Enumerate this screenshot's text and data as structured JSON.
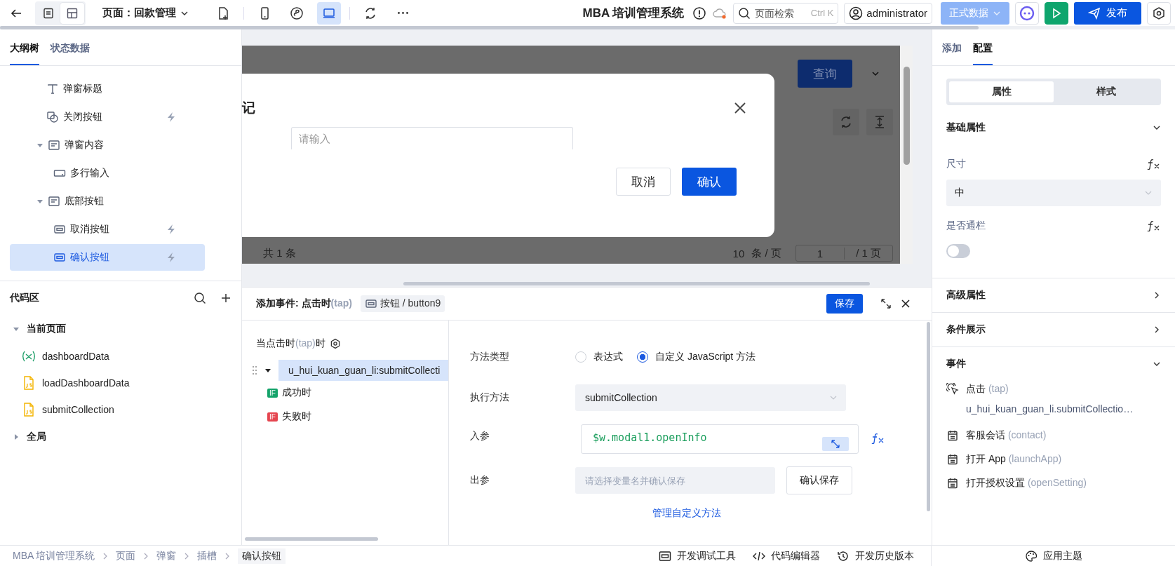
{
  "top_bar": {
    "view_modes": [
      {
        "kind": "list",
        "selected": false
      },
      {
        "kind": "layout",
        "selected": true
      }
    ],
    "page_selector": "页面：回款管理",
    "devices": [
      {
        "kind": "add",
        "selected": false
      },
      {
        "kind": "phone",
        "selected": false
      },
      {
        "kind": "mini",
        "selected": false
      },
      {
        "kind": "desktop",
        "selected": true
      },
      {
        "kind": "refresh",
        "selected": false
      },
      {
        "kind": "more",
        "selected": false
      }
    ],
    "app_title": "MBA 培训管理系统",
    "search": {
      "placeholder": "页面检索",
      "shortcut": "Ctrl K"
    },
    "user": "administrator",
    "env_button": "正式数据",
    "publish_button": "发布"
  },
  "left_panel": {
    "tabs": [
      {
        "label": "大纲树",
        "selected": true
      },
      {
        "label": "状态数据",
        "selected": false
      }
    ],
    "outline": [
      {
        "label": "弹窗标题",
        "kind": "text",
        "has_event": false,
        "selected": false
      },
      {
        "label": "关闭按钮",
        "kind": "shape",
        "has_event": true,
        "selected": false
      },
      {
        "label": "弹窗内容",
        "kind": "container",
        "has_event": false,
        "selected": false,
        "expanded": true,
        "children": [
          {
            "label": "多行输入",
            "kind": "input",
            "has_event": false,
            "selected": false
          }
        ]
      },
      {
        "label": "底部按钮",
        "kind": "container",
        "has_event": false,
        "selected": false,
        "expanded": true,
        "children": [
          {
            "label": "取消按钮",
            "kind": "button",
            "has_event": true,
            "selected": false
          },
          {
            "label": "确认按钮",
            "kind": "button",
            "has_event": true,
            "selected": true
          }
        ]
      }
    ],
    "code_area": {
      "title": "代码区",
      "groups": [
        {
          "label": "当前页面",
          "expanded": true,
          "children": [
            {
              "label": "dashboardData",
              "kind": "variable"
            },
            {
              "label": "loadDashboardData",
              "kind": "js"
            },
            {
              "label": "submitCollection",
              "kind": "js"
            }
          ]
        },
        {
          "label": "全局",
          "expanded": false
        }
      ]
    }
  },
  "canvas": {
    "query_button": "查询",
    "modal": {
      "title": "记",
      "placeholder": "请输入",
      "cancel": "取消",
      "confirm": "确认"
    },
    "pagination": {
      "total": "共 1 条",
      "page_size": "10",
      "per_page": "条 / 页",
      "page": "1",
      "pages": "/ 1 页"
    }
  },
  "event_panel": {
    "title": "添加事件: 点击时",
    "title_code": "(tap)",
    "target": "按钮 / button9",
    "save": "保存",
    "trigger": {
      "label": "当点击时",
      "code": "(tap)",
      "suffix": "时"
    },
    "actions": [
      {
        "label": "u_hui_kuan_guan_li:submitCollecti",
        "selected": true,
        "expanded": true,
        "branches": [
          {
            "badge": "IF",
            "label": "成功时",
            "kind": "success"
          },
          {
            "badge": "IF",
            "label": "失败时",
            "kind": "failure"
          }
        ]
      }
    ],
    "form": {
      "method_type": {
        "label": "方法类型",
        "options": [
          {
            "label": "表达式",
            "selected": false
          },
          {
            "label": "自定义 JavaScript 方法",
            "selected": true
          }
        ]
      },
      "method": {
        "label": "执行方法",
        "value": "submitCollection"
      },
      "input": {
        "label": "入参",
        "value": "$w.modal1.openInfo"
      },
      "output": {
        "label": "出参",
        "placeholder": "请选择变量名并确认保存",
        "button": "确认保存"
      },
      "manage_link": "管理自定义方法"
    }
  },
  "right_panel": {
    "tabs": [
      {
        "label": "添加",
        "selected": false
      },
      {
        "label": "配置",
        "selected": true
      }
    ],
    "segments": [
      {
        "label": "属性",
        "selected": true
      },
      {
        "label": "样式",
        "selected": false
      }
    ],
    "sections": [
      {
        "kind": "basic",
        "title": "基础属性",
        "expanded": true,
        "size": {
          "label": "尺寸",
          "value": "中"
        },
        "full_width": {
          "label": "是否通栏",
          "on": false
        }
      },
      {
        "kind": "plain",
        "title": "高级属性",
        "expanded": false
      },
      {
        "kind": "plain",
        "title": "条件展示",
        "expanded": false
      },
      {
        "kind": "events",
        "title": "事件",
        "expanded": true,
        "items": [
          {
            "kind": "tap",
            "label": "点击",
            "code": "(tap)",
            "handler": "u_hui_kuan_guan_li.submitCollectio…"
          },
          {
            "kind": "system",
            "label": "客服会话",
            "code": "(contact)"
          },
          {
            "kind": "system",
            "label": "打开 App",
            "code": "(launchApp)"
          },
          {
            "kind": "system",
            "label": "打开授权设置",
            "code": "(openSetting)"
          }
        ]
      }
    ]
  },
  "status_bar": {
    "breadcrumb": [
      "MBA 培训管理系统",
      "页面",
      "弹窗",
      "插槽",
      "确认按钮"
    ],
    "tools": [
      {
        "kind": "debug",
        "label": "开发调试工具"
      },
      {
        "kind": "code",
        "label": "代码编辑器"
      },
      {
        "kind": "history",
        "label": "开发历史版本"
      }
    ],
    "theme": "应用主题"
  }
}
